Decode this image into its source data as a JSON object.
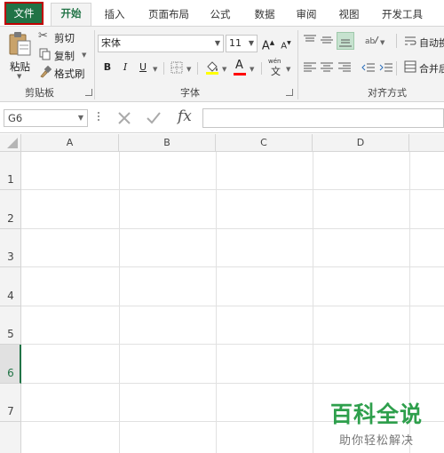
{
  "tabs": {
    "file": "文件",
    "home": "开始",
    "insert": "插入",
    "page_layout": "页面布局",
    "formulas": "公式",
    "data": "数据",
    "review": "审阅",
    "view": "视图",
    "developer": "开发工具"
  },
  "clipboard": {
    "paste": "粘贴",
    "cut": "剪切",
    "copy": "复制",
    "format_painter": "格式刷",
    "group_label": "剪贴板"
  },
  "font": {
    "name": "宋体",
    "size": "11",
    "bold": "B",
    "italic": "I",
    "underline": "U",
    "grow": "A",
    "shrink": "A",
    "font_color": "A",
    "phonetic_top": "wén",
    "phonetic_char": "文",
    "group_label": "字体"
  },
  "alignment": {
    "wrap_text": "自动换",
    "merge": "合并后",
    "group_label": "对齐方式"
  },
  "formula_bar": {
    "cell_ref": "G6",
    "fx": "fx"
  },
  "columns": [
    "A",
    "B",
    "C",
    "D"
  ],
  "rows": [
    "1",
    "2",
    "3",
    "4",
    "5",
    "6",
    "7"
  ],
  "selected_row": "6",
  "colors": {
    "accent": "#217346",
    "file_tab_outline": "#c00000",
    "highlight_yellow": "#ffff00",
    "font_red": "#ff0000",
    "watermark": "#2e9f4c"
  },
  "watermark": {
    "title": "百科全说",
    "subtitle": "助你轻松解决"
  }
}
